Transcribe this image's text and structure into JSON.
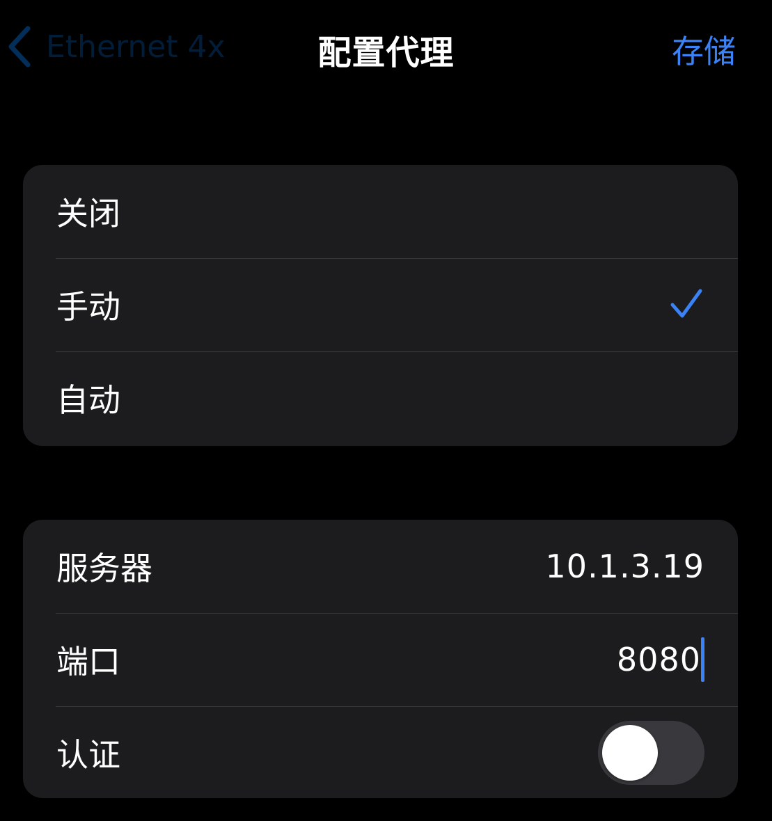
{
  "nav": {
    "back_label": "Ethernet 4x",
    "title": "配置代理",
    "save_label": "存储"
  },
  "proxy_mode": {
    "options": [
      {
        "label": "关闭",
        "selected": false
      },
      {
        "label": "手动",
        "selected": true
      },
      {
        "label": "自动",
        "selected": false
      }
    ]
  },
  "manual_proxy": {
    "server_label": "服务器",
    "server_value": "10.1.3.19",
    "port_label": "端口",
    "port_value": "8080",
    "auth_label": "认证",
    "auth_enabled": false
  },
  "colors": {
    "accent": "#3b82f6",
    "background": "#000000",
    "group_background": "#1c1c1e",
    "separator": "#38383a",
    "toggle_off": "#39393d"
  },
  "icons": {
    "back": "chevron-left-icon",
    "selected": "checkmark-icon"
  }
}
